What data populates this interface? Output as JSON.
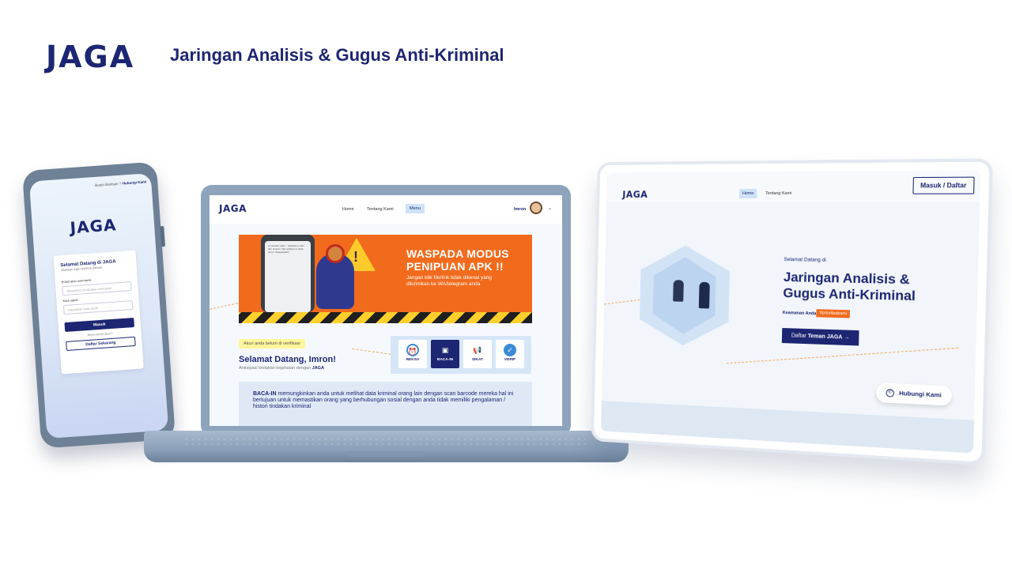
{
  "brand": {
    "logo": "JAGA",
    "title": "Jaringan Analisis & Gugus Anti-Kriminal"
  },
  "phone": {
    "top_hint": "Butuh Bantuan ?",
    "top_link": "Hubungi Kami",
    "logo": "JAGA",
    "login": {
      "title": "Selamat Datang di JAGA",
      "subtitle": "Silahkan login terlebih dahulu",
      "email_label": "Email atau username",
      "email_placeholder": "Masukkan email atau username",
      "password_label": "Kata sandi",
      "password_placeholder": "Masukkan kata sandi",
      "login_button": "Masuk",
      "no_account": "Belum punya akun ?",
      "register_button": "Daftar Sekarang"
    }
  },
  "laptop": {
    "nav": {
      "logo": "JAGA",
      "home": "Home",
      "about": "Tentang Kami",
      "menu": "Menu",
      "user": "Imron"
    },
    "banner": {
      "title_line1": "WASPADA MODUS",
      "title_line2": "PENIPUAN APK !!",
      "desc": "Jangan klik file/link tidak dikenal yang dikirimkan ke WA/telegram anda",
      "phone_text": "Ini sebuah video... Silahkan unduh dan simpan. Tapi aplikasi ini tidak aman. Waspadalah!"
    },
    "verify_tag": "Akun anda belum di verifikasi",
    "welcome": "Selamat Datang, Imron!",
    "welcome_sub": "Antisipasi tindakan kejahatan dengan",
    "welcome_sub_brand": "JAGA",
    "features": [
      {
        "label": "REKSA",
        "icon": "alarm-icon"
      },
      {
        "label": "BACA-IN",
        "icon": "scan-icon"
      },
      {
        "label": "SIKAT",
        "icon": "megaphone-icon"
      },
      {
        "label": "VERIF",
        "icon": "verified-icon"
      }
    ],
    "info": {
      "highlight": "BACA-IN",
      "text": "memungkinkan anda untuk melihat data kriminal orang lain dengan scan barcode mereka hal ini bertujuan untuk memastikan orang yang berhubungan sosial dengan anda tidak memiliki pengalaman / histori tindakan kriminal"
    }
  },
  "tablet": {
    "nav": {
      "logo": "JAGA",
      "home": "Home",
      "about": "Tentang Kami",
      "login": "Masuk / Daftar"
    },
    "welcome": "Selamat Datang di",
    "title_line1": "Jaringan Analisis &",
    "title_line2": "Gugus Anti-Kriminal",
    "safety": "Keamanan Anda",
    "tag": "#prioritaskami",
    "cta_prefix": "Daftar",
    "cta_bold": "Teman JAGA",
    "cta_arrow": "→",
    "contact": "Hubungi Kami"
  },
  "colors": {
    "navy": "#1d2672",
    "orange": "#f26b1d",
    "yellow": "#ffcf2b",
    "light_blue": "#cfe3f7"
  }
}
